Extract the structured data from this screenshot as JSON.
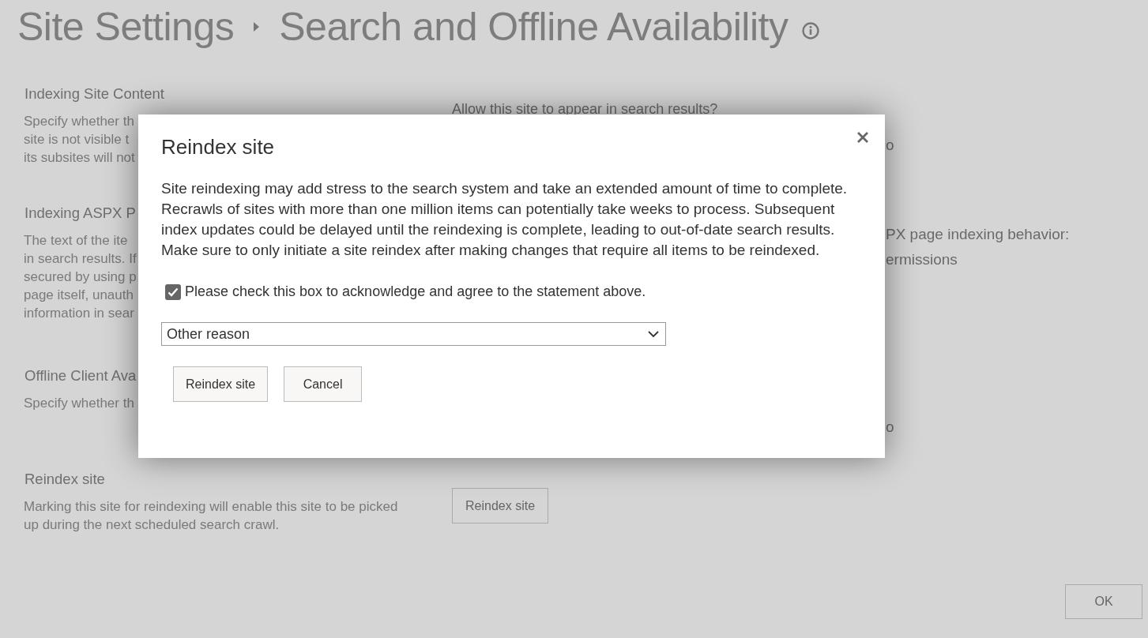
{
  "page": {
    "title": "Site Settings",
    "subtitle": "Search and Offline Availability"
  },
  "sections": [
    {
      "heading": "Indexing Site Content",
      "description": [
        "Specify whether th",
        "site is not visible t",
        "its subsites will not"
      ],
      "setting": {
        "kind": "text",
        "text": "Allow this site to appear in search results?"
      },
      "right_fragments": [
        "o"
      ]
    },
    {
      "heading": "Indexing ASPX P",
      "description": [
        "The text of the ite",
        "in search results. If",
        "secured by using p",
        "page itself, unauth",
        "information in sear"
      ],
      "right_fragments": [
        "PX page indexing behavior:",
        "ermissions"
      ]
    },
    {
      "heading": "Offline Client Ava",
      "description": [
        "Specify whether th"
      ],
      "right_fragments": [
        "o"
      ]
    },
    {
      "heading": "Reindex site",
      "description": [
        "Marking this site for reindexing will enable this site to be picked",
        "up during the next scheduled search crawl."
      ],
      "setting": {
        "kind": "button",
        "text": "Reindex site"
      }
    }
  ],
  "ok_button": "OK",
  "dialog": {
    "title": "Reindex site",
    "body": "Site reindexing may add stress to the search system and take an extended amount of time to complete. Recrawls of sites with more than one million items can potentially take weeks to process. Subsequent index updates could be delayed until the reindexing is complete, leading to out-of-date search results. Make sure to only initiate a site reindex after making changes that require all items to be reindexed.",
    "acknowledge": {
      "label": "Please check this box to acknowledge and agree to the statement above.",
      "checked": true
    },
    "reason": {
      "value": "Other reason"
    },
    "buttons": [
      "Reindex site",
      "Cancel"
    ]
  }
}
